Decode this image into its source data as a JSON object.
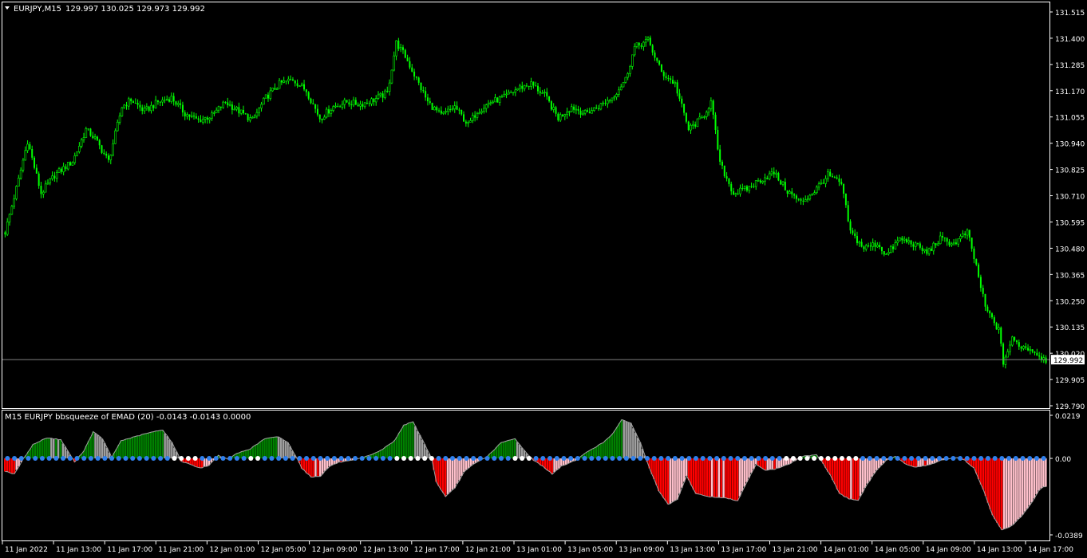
{
  "colors": {
    "background": "#000000",
    "frame": "#ffffff",
    "bull": "#00ff00",
    "bear": "#00ff00",
    "text": "#ffffff",
    "hist_pos": "#008000",
    "hist_neg": "#ff0000",
    "hist_pale": "#ffc0cb",
    "hist_outline": "#a0a0a0",
    "squeeze_on": "#2f80ed",
    "squeeze_off": "#ffffff"
  },
  "main_header": {
    "menu_icon": "triangle-down-icon",
    "symbol": "EURJPY,M15",
    "ohlc": "129.997 130.025 129.973 129.992"
  },
  "price_axis": {
    "ticks": [
      "131.515",
      "131.400",
      "131.285",
      "131.170",
      "131.055",
      "130.940",
      "130.825",
      "130.710",
      "130.595",
      "130.480",
      "130.365",
      "130.250",
      "130.135",
      "130.020",
      "129.905",
      "129.790"
    ],
    "current_price": "129.992"
  },
  "time_axis": {
    "labels": [
      "11 Jan 2022",
      "11 Jan 13:00",
      "11 Jan 17:00",
      "11 Jan 21:00",
      "12 Jan 01:00",
      "12 Jan 05:00",
      "12 Jan 09:00",
      "12 Jan 13:00",
      "12 Jan 17:00",
      "12 Jan 21:00",
      "13 Jan 01:00",
      "13 Jan 05:00",
      "13 Jan 09:00",
      "13 Jan 13:00",
      "13 Jan 17:00",
      "13 Jan 21:00",
      "14 Jan 01:00",
      "14 Jan 05:00",
      "14 Jan 09:00",
      "14 Jan 13:00",
      "14 Jan 17:00"
    ]
  },
  "indicator": {
    "label": "M15 EURJPY bbsqueeze of EMAD (20) -0.0143 -0.0143 0.0000",
    "axis_ticks": [
      "0.0219",
      "0.00",
      "-0.0389"
    ]
  },
  "chart_data": [
    {
      "type": "candlestick",
      "title": "EURJPY,M15",
      "ylim": [
        129.79,
        131.515
      ],
      "anchors_close": [
        [
          0,
          130.55
        ],
        [
          6,
          130.78
        ],
        [
          10,
          130.95
        ],
        [
          16,
          130.72
        ],
        [
          22,
          130.8
        ],
        [
          30,
          130.86
        ],
        [
          36,
          131.0
        ],
        [
          40,
          130.96
        ],
        [
          46,
          130.86
        ],
        [
          52,
          131.1
        ],
        [
          56,
          131.13
        ],
        [
          62,
          131.08
        ],
        [
          68,
          131.12
        ],
        [
          74,
          131.14
        ],
        [
          80,
          131.07
        ],
        [
          86,
          131.04
        ],
        [
          92,
          131.06
        ],
        [
          98,
          131.12
        ],
        [
          104,
          131.08
        ],
        [
          110,
          131.04
        ],
        [
          116,
          131.14
        ],
        [
          122,
          131.2
        ],
        [
          128,
          131.22
        ],
        [
          134,
          131.17
        ],
        [
          140,
          131.05
        ],
        [
          146,
          131.1
        ],
        [
          152,
          131.12
        ],
        [
          158,
          131.11
        ],
        [
          164,
          131.13
        ],
        [
          170,
          131.16
        ],
        [
          174,
          131.38
        ],
        [
          178,
          131.32
        ],
        [
          182,
          131.24
        ],
        [
          188,
          131.12
        ],
        [
          194,
          131.06
        ],
        [
          200,
          131.1
        ],
        [
          206,
          131.02
        ],
        [
          210,
          131.08
        ],
        [
          216,
          131.12
        ],
        [
          222,
          131.14
        ],
        [
          228,
          131.18
        ],
        [
          234,
          131.2
        ],
        [
          240,
          131.15
        ],
        [
          246,
          131.05
        ],
        [
          252,
          131.1
        ],
        [
          258,
          131.07
        ],
        [
          264,
          131.1
        ],
        [
          270,
          131.14
        ],
        [
          276,
          131.22
        ],
        [
          280,
          131.36
        ],
        [
          286,
          131.39
        ],
        [
          292,
          131.25
        ],
        [
          298,
          131.2
        ],
        [
          304,
          131.0
        ],
        [
          310,
          131.05
        ],
        [
          314,
          131.12
        ],
        [
          318,
          130.85
        ],
        [
          324,
          130.72
        ],
        [
          330,
          130.74
        ],
        [
          336,
          130.78
        ],
        [
          342,
          130.81
        ],
        [
          348,
          130.73
        ],
        [
          354,
          130.68
        ],
        [
          360,
          130.73
        ],
        [
          366,
          130.8
        ],
        [
          372,
          130.76
        ],
        [
          376,
          130.55
        ],
        [
          382,
          130.48
        ],
        [
          388,
          130.5
        ],
        [
          392,
          130.45
        ],
        [
          398,
          130.52
        ],
        [
          404,
          130.5
        ],
        [
          410,
          130.46
        ],
        [
          416,
          130.52
        ],
        [
          422,
          130.5
        ],
        [
          428,
          130.55
        ],
        [
          432,
          130.4
        ],
        [
          436,
          130.22
        ],
        [
          442,
          130.12
        ],
        [
          444,
          129.98
        ],
        [
          448,
          130.08
        ],
        [
          452,
          130.05
        ],
        [
          456,
          130.04
        ],
        [
          460,
          130.01
        ],
        [
          463,
          129.99
        ]
      ],
      "candle_count": 464
    },
    {
      "type": "bar",
      "title": "bbsqueeze of EMAD (20)",
      "ylim": [
        -0.0389,
        0.0219
      ],
      "anchors": [
        [
          0,
          -0.0065
        ],
        [
          4,
          -0.008
        ],
        [
          8,
          0.0
        ],
        [
          12,
          0.007
        ],
        [
          18,
          0.0105
        ],
        [
          24,
          0.0095
        ],
        [
          28,
          0.002
        ],
        [
          30,
          -0.002
        ],
        [
          34,
          0.004
        ],
        [
          38,
          0.0135
        ],
        [
          42,
          0.01
        ],
        [
          46,
          0.0005
        ],
        [
          50,
          0.009
        ],
        [
          56,
          0.011
        ],
        [
          62,
          0.013
        ],
        [
          68,
          0.0145
        ],
        [
          72,
          0.008
        ],
        [
          76,
          -0.0015
        ],
        [
          80,
          -0.003
        ],
        [
          84,
          -0.005
        ],
        [
          88,
          -0.0035
        ],
        [
          92,
          0.0015
        ],
        [
          96,
          -0.0005
        ],
        [
          100,
          0.0025
        ],
        [
          106,
          0.005
        ],
        [
          112,
          0.01
        ],
        [
          118,
          0.011
        ],
        [
          122,
          0.008
        ],
        [
          126,
          0.0
        ],
        [
          128,
          -0.005
        ],
        [
          132,
          -0.0095
        ],
        [
          136,
          -0.009
        ],
        [
          140,
          -0.004
        ],
        [
          144,
          -0.002
        ],
        [
          150,
          -0.001
        ],
        [
          156,
          0.001
        ],
        [
          162,
          0.004
        ],
        [
          168,
          0.009
        ],
        [
          172,
          0.017
        ],
        [
          176,
          0.0185
        ],
        [
          180,
          0.0095
        ],
        [
          184,
          0.0
        ],
        [
          186,
          -0.012
        ],
        [
          190,
          -0.0195
        ],
        [
          194,
          -0.015
        ],
        [
          198,
          -0.007
        ],
        [
          202,
          -0.003
        ],
        [
          208,
          0.001
        ],
        [
          214,
          0.008
        ],
        [
          220,
          0.01
        ],
        [
          224,
          0.004
        ],
        [
          228,
          -0.001
        ],
        [
          232,
          -0.004
        ],
        [
          236,
          -0.008
        ],
        [
          240,
          -0.004
        ],
        [
          246,
          -0.001
        ],
        [
          252,
          0.004
        ],
        [
          258,
          0.008
        ],
        [
          262,
          0.0125
        ],
        [
          266,
          0.0195
        ],
        [
          270,
          0.018
        ],
        [
          274,
          0.008
        ],
        [
          278,
          -0.005
        ],
        [
          282,
          -0.0165
        ],
        [
          286,
          -0.0235
        ],
        [
          290,
          -0.021
        ],
        [
          294,
          -0.009
        ],
        [
          298,
          -0.018
        ],
        [
          304,
          -0.0195
        ],
        [
          310,
          -0.02
        ],
        [
          316,
          -0.0215
        ],
        [
          320,
          -0.012
        ],
        [
          324,
          -0.003
        ],
        [
          328,
          -0.006
        ],
        [
          332,
          -0.0055
        ],
        [
          338,
          -0.003
        ],
        [
          344,
          0.001
        ],
        [
          350,
          0.002
        ],
        [
          352,
          -0.001
        ],
        [
          356,
          -0.0085
        ],
        [
          360,
          -0.018
        ],
        [
          364,
          -0.0205
        ],
        [
          368,
          -0.0215
        ],
        [
          372,
          -0.013
        ],
        [
          376,
          -0.006
        ],
        [
          380,
          -0.001
        ],
        [
          384,
          0.001
        ],
        [
          388,
          -0.0025
        ],
        [
          392,
          -0.0045
        ],
        [
          398,
          -0.0035
        ],
        [
          404,
          -0.001
        ],
        [
          410,
          0.0005
        ],
        [
          414,
          -0.001
        ],
        [
          418,
          -0.005
        ],
        [
          422,
          -0.016
        ],
        [
          426,
          -0.029
        ],
        [
          430,
          -0.0365
        ],
        [
          434,
          -0.0345
        ],
        [
          438,
          -0.03
        ],
        [
          442,
          -0.024
        ],
        [
          446,
          -0.0165
        ],
        [
          448,
          -0.0143
        ]
      ],
      "squeeze_off_ranges": [
        [
          24,
          27
        ],
        [
          35,
          36
        ],
        [
          56,
          61
        ],
        [
          73,
          75
        ],
        [
          112,
          122
        ],
        [
          150,
          159
        ],
        [
          166,
          169
        ],
        [
          193,
          197
        ],
        [
          244,
          248
        ],
        [
          262,
          265
        ],
        [
          277,
          286
        ],
        [
          322,
          330
        ],
        [
          344,
          352
        ]
      ],
      "bar_count": 450
    }
  ]
}
